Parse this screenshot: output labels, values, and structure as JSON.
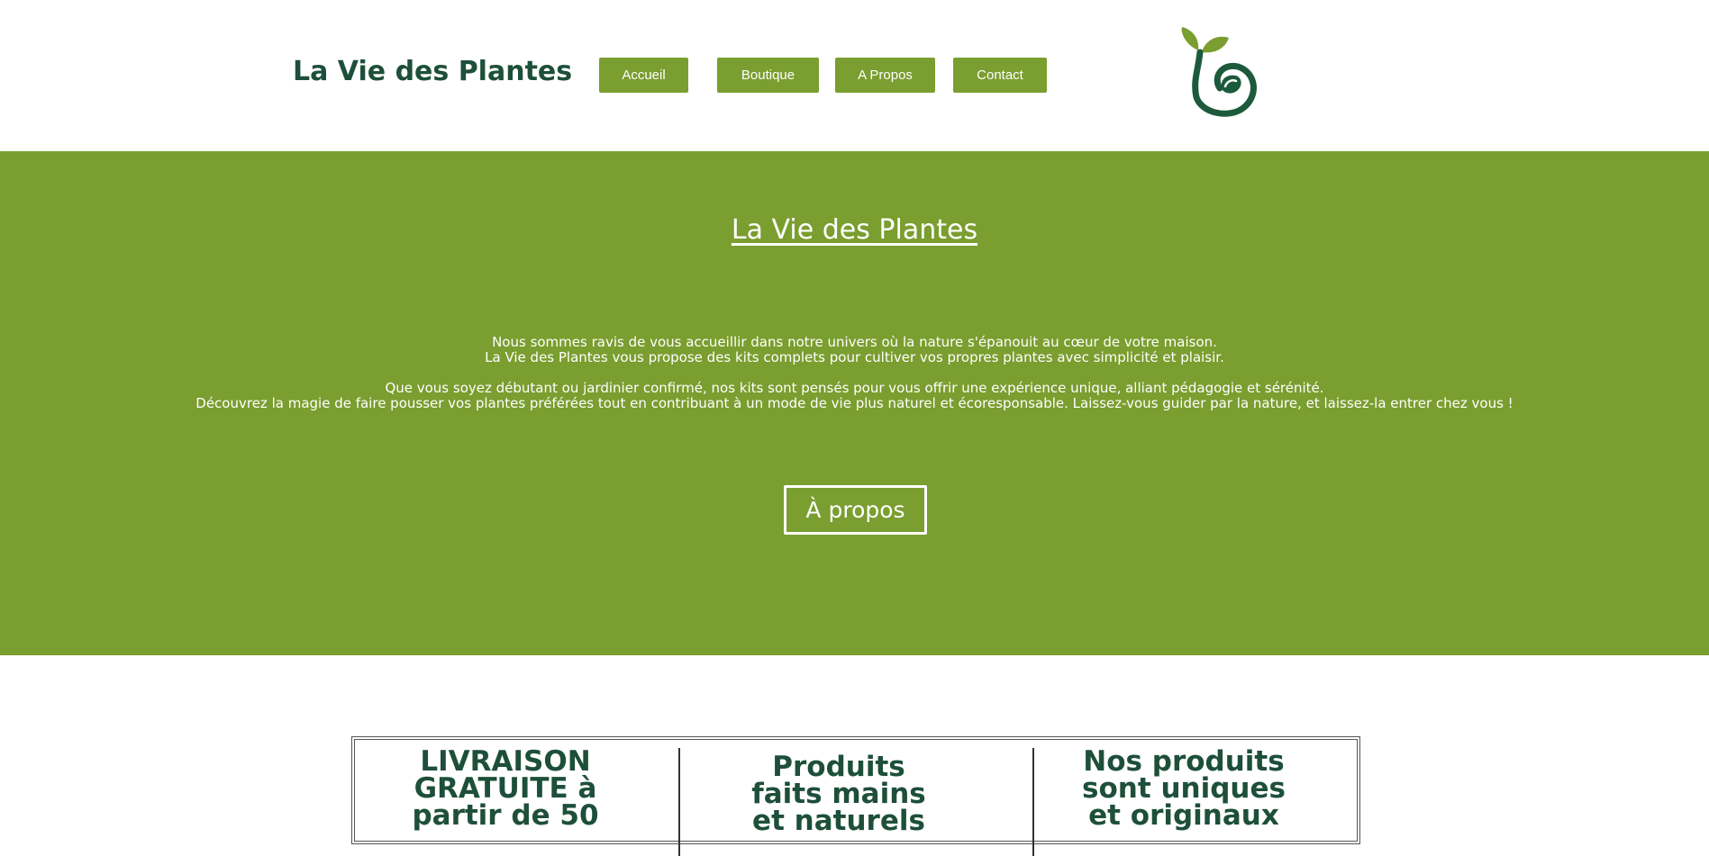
{
  "header": {
    "site_title": "La Vie des Plantes",
    "nav": [
      {
        "label": "Accueil"
      },
      {
        "label": "Boutique"
      },
      {
        "label": "A Propos"
      },
      {
        "label": "Contact"
      }
    ],
    "logo_icon": "sprout-swirl-logo"
  },
  "hero": {
    "title": "La Vie des Plantes",
    "paragraphs": [
      "Nous sommes ravis de vous accueillir dans notre univers où la nature s'épanouit au cœur de votre maison.",
      "La Vie des Plantes vous propose des kits complets pour cultiver vos propres plantes avec simplicité et plaisir.",
      "Que vous soyez débutant ou jardinier confirmé, nos kits sont pensés pour vous offrir une expérience unique, alliant pédagogie et sérénité.",
      "Découvrez la magie de faire pousser vos plantes préférées tout en contribuant à un mode de vie plus naturel et écoresponsable. Laissez-vous guider par la nature, et laissez-la entrer chez vous !"
    ],
    "button_label": "À propos"
  },
  "features": [
    {
      "text": "LIVRAISON GRATUITE à partir de 50"
    },
    {
      "text": "Produits faits mains et naturels"
    },
    {
      "text": "Nos produits sont uniques et originaux"
    }
  ],
  "colors": {
    "accent_green": "#7a9e2f",
    "dark_green": "#1d4f3a",
    "background": "#ffffff"
  }
}
